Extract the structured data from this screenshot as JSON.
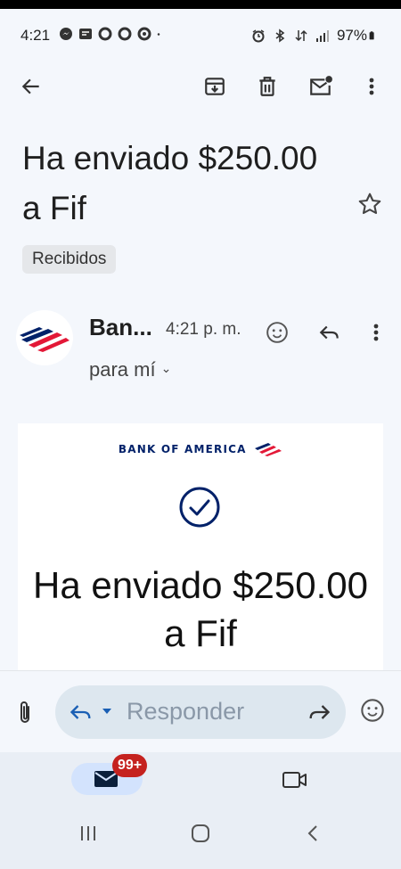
{
  "status_bar": {
    "time": "4:21",
    "battery": "97%",
    "left_icons": [
      "messenger-icon",
      "mail-notification-icon",
      "circle-notification-icon",
      "circle-notification-icon",
      "circle-notification-icon",
      "dot-icon"
    ],
    "right_icons": [
      "alarm-icon",
      "bluetooth-icon",
      "data-arrows-icon",
      "signal-icon",
      "battery-icon"
    ]
  },
  "toolbar": {
    "back": "back-arrow-icon",
    "archive": "archive-icon",
    "delete": "trash-icon",
    "mark_unread": "mark-unread-icon",
    "more": "more-vert-icon"
  },
  "email": {
    "subject": "Ha enviado $250.00 a Fif",
    "label": "Recibidos",
    "sender_short": "Ban...",
    "time": "4:21 p. m.",
    "recipient": "para mí"
  },
  "body": {
    "brand": "BANK OF AMERICA",
    "headline": "Ha enviado $250.00 a Fif"
  },
  "reply_bar": {
    "placeholder": "Responder"
  },
  "bottom_nav": {
    "mail_badge": "99+"
  },
  "colors": {
    "background": "#f4f7fc",
    "boa_blue": "#012169",
    "boa_red": "#e31837",
    "badge_red": "#c5221f",
    "pill_blue": "#d3e3fd"
  }
}
